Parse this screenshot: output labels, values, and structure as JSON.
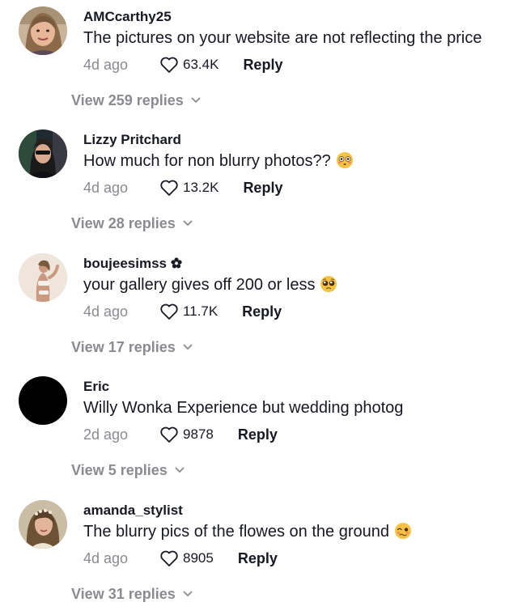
{
  "comments": [
    {
      "username": "AMCcarthy25",
      "text": "The pictures on your website are not reflecting the price",
      "time": "4d ago",
      "likes": "63.4K",
      "reply_label": "Reply",
      "view_replies": "View 259 replies",
      "emoji": null
    },
    {
      "username": "Lizzy Pritchard",
      "text": "How much for non blurry photos??",
      "time": "4d ago",
      "likes": "13.2K",
      "reply_label": "Reply",
      "view_replies": "View 28 replies",
      "emoji": "flushed-face-emoji"
    },
    {
      "username": "boujeesimss",
      "text": "your gallery gives off 200 or less",
      "time": "4d ago",
      "likes": "11.7K",
      "reply_label": "Reply",
      "view_replies": "View 17 replies",
      "emoji": "pleading-face-emoji",
      "badge": "flower-badge-icon"
    },
    {
      "username": "Eric",
      "text": "Willy Wonka Experience but wedding photog",
      "time": "2d ago",
      "likes": "9878",
      "reply_label": "Reply",
      "view_replies": "View 5 replies",
      "emoji": null
    },
    {
      "username": "amanda_stylist",
      "text": "The blurry pics of the flowes on the ground",
      "time": "4d ago",
      "likes": "8905",
      "reply_label": "Reply",
      "view_replies": "View 31 replies",
      "emoji": "woozy-face-emoji"
    }
  ],
  "colors": {
    "primary_text": "#161823",
    "secondary_text": "#8a8b91",
    "emoji_yellow": "#f6c244"
  }
}
